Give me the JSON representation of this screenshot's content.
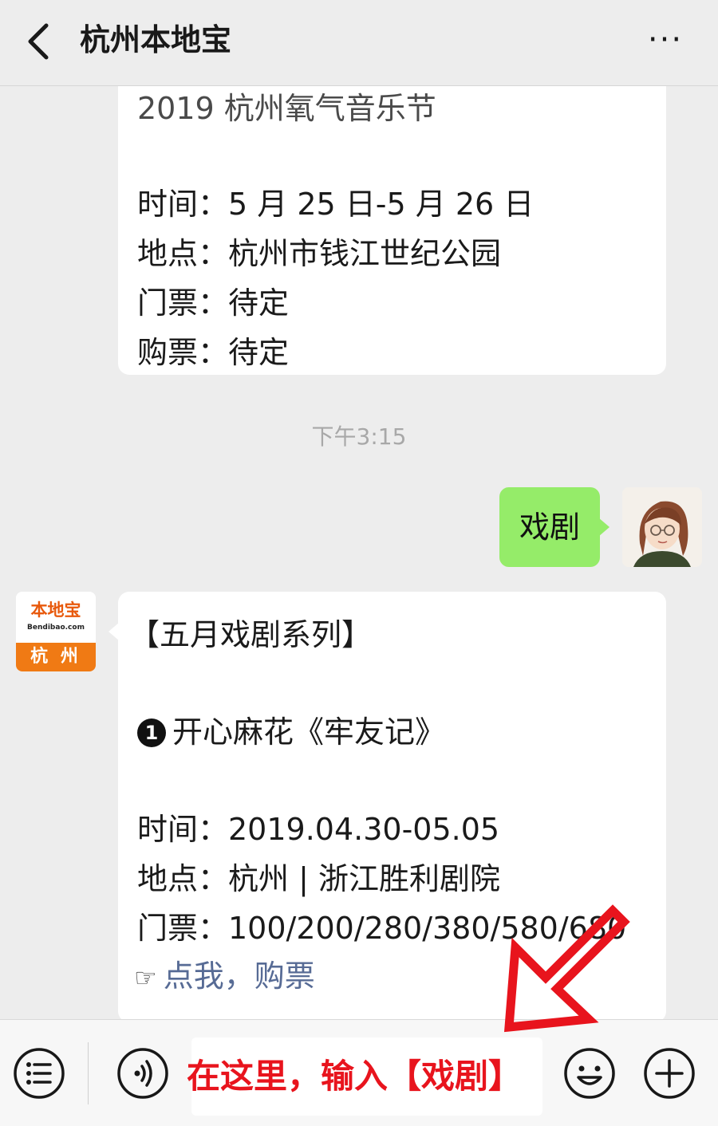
{
  "header": {
    "title": "杭州本地宝",
    "back_icon": "chevron-left-icon",
    "more_label": "···"
  },
  "messages": {
    "event1": {
      "title_partial": "2019 杭州氧气音乐节",
      "time": "时间：5 月 25 日-5 月 26 日",
      "place": "地点：杭州市钱江世纪公园",
      "ticket": "门票：待定",
      "purchase": "购票：待定"
    },
    "timestamp": "下午3:15",
    "user_message": "戏剧",
    "reply": {
      "heading": "【五月戏剧系列】",
      "item_number": "1",
      "item_title": "开心麻花《牢友记》",
      "time": "时间：2019.04.30-05.05",
      "place": "地点：杭州 | 浙江胜利剧院",
      "ticket": "门票：100/200/280/380/580/680",
      "buy_pointer": "☞",
      "buy_link": "点我，购票"
    },
    "official_avatar": {
      "brand": "本地宝",
      "site": "Bendibao.com",
      "city": "杭 州"
    }
  },
  "toolbar": {
    "menu_icon": "menu-list-icon",
    "voice_icon": "voice-icon",
    "input_annotation": "在这里，输入【戏剧】",
    "emoji_icon": "smiley-icon",
    "plus_icon": "plus-icon"
  },
  "colors": {
    "background": "#ededed",
    "green_bubble": "#95ec69",
    "link": "#576b95",
    "annotation_red": "#e8141d",
    "brand_orange": "#f07a14"
  }
}
